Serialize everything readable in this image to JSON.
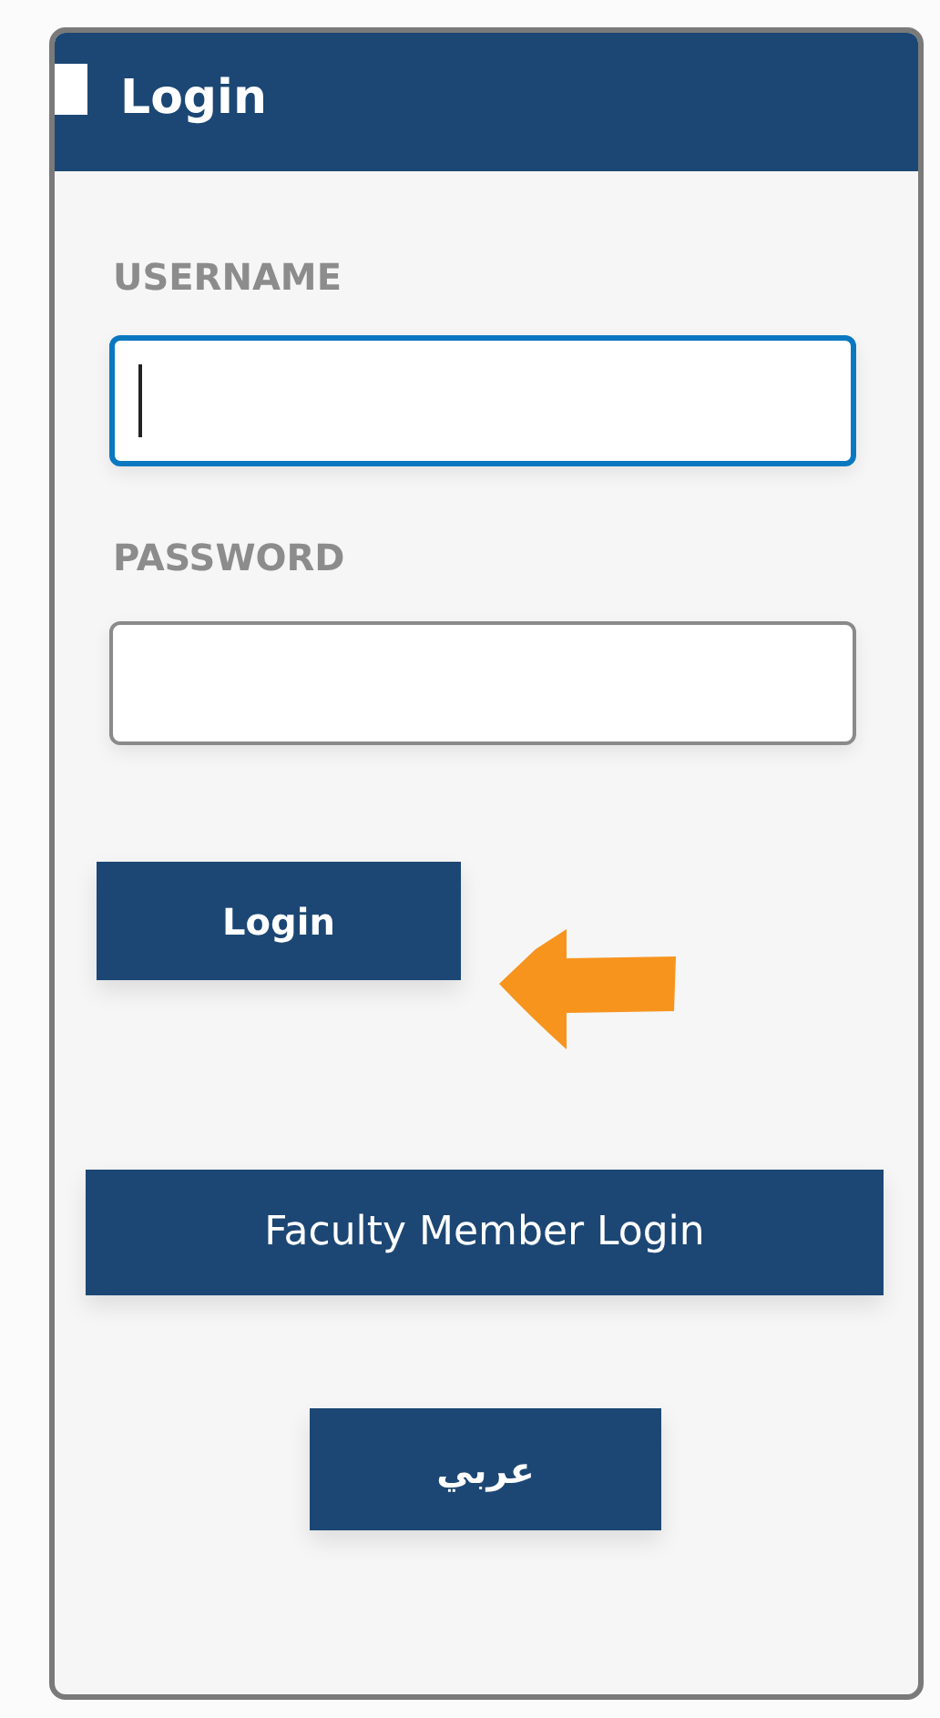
{
  "header": {
    "title": "Login"
  },
  "fields": [
    {
      "label": "USERNAME",
      "focused": true
    },
    {
      "label": "PASSWORD",
      "focused": false
    }
  ],
  "login_button": "Login",
  "faculty_button": "Faculty Member Login",
  "language_button": "عربي"
}
